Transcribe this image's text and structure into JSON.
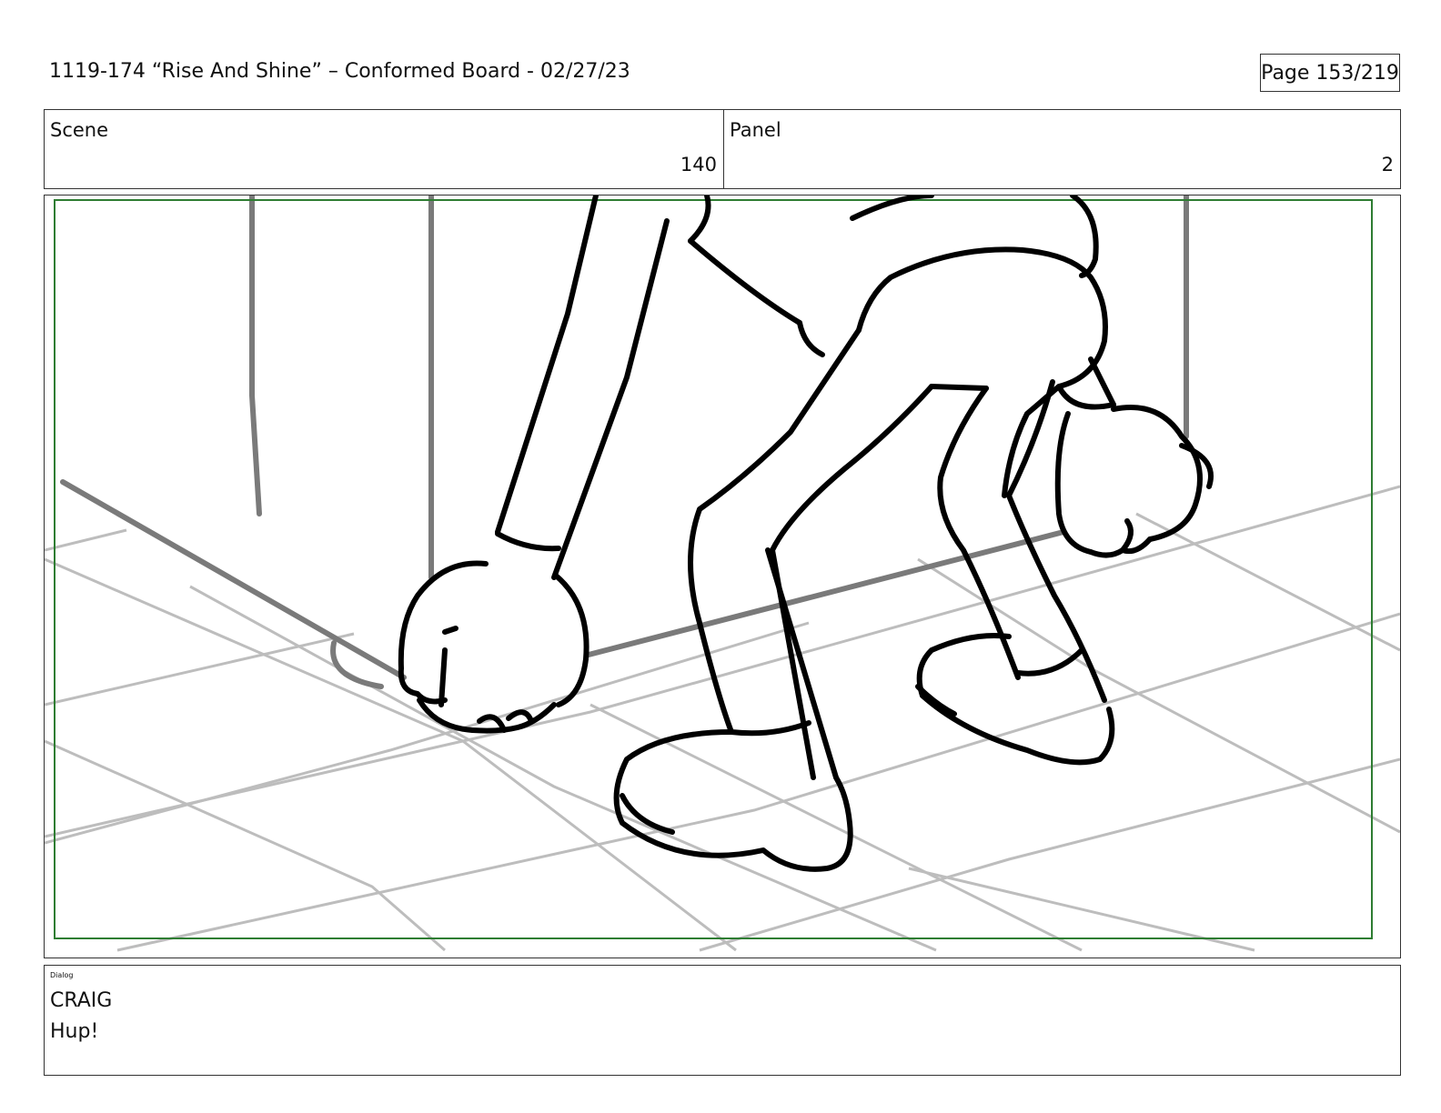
{
  "header": {
    "title": "1119-174 “Rise And Shine” – Conformed Board - 02/27/23",
    "page": "Page 153/219"
  },
  "scene": {
    "label": "Scene",
    "value": "140"
  },
  "panel": {
    "label": "Panel",
    "value": "2"
  },
  "frame": {
    "border_color": "#2e7d32"
  },
  "dialog": {
    "label": "Dialog",
    "speaker": "CRAIG",
    "line": "Hup!"
  }
}
